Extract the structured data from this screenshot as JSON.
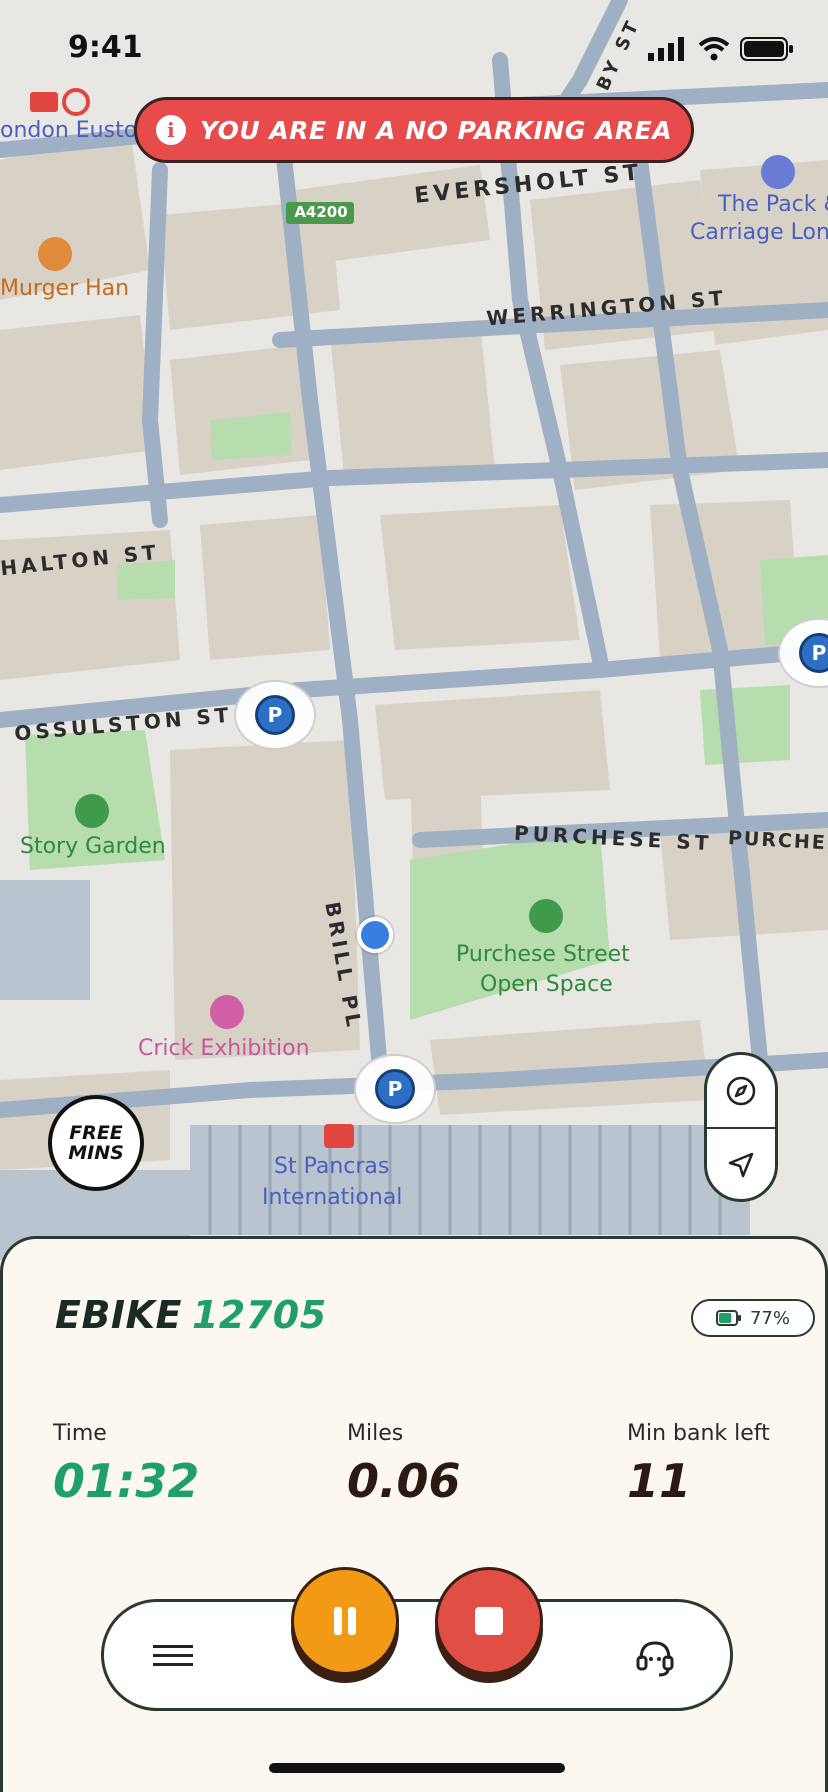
{
  "status_bar": {
    "time": "9:41"
  },
  "banner": {
    "text": "YOU ARE IN A NO PARKING AREA",
    "info_glyph": "i",
    "color": "#e84b4b"
  },
  "map": {
    "streets": {
      "eversholt": "EVERSHOLT ST",
      "werrington": "WERRINGTON ST",
      "chalton": "HALTON ST",
      "ossulston": "OSSULSTON ST",
      "purchese": "PURCHESE ST",
      "purchese2": "PURCHES",
      "brill": "BRILL PL",
      "top": "BY ST",
      "road_badge": "A4200"
    },
    "pois": {
      "euston": "ondon Eustor",
      "burger": "Murger Han",
      "pack": "The Pack &",
      "pack2": "Carriage Lon",
      "story_garden": "Story Garden",
      "purchese_space": "Purchese Street",
      "purchese_space2": "Open Space",
      "crick": "Crick Exhibition",
      "st_pancras": "St Pancras",
      "st_pancras2": "International"
    },
    "parking_letter": "P"
  },
  "free_mins": {
    "line1": "FREE",
    "line2": "MINS"
  },
  "ride": {
    "type": "EBIKE",
    "number": "12705",
    "battery": "77%",
    "battery_level": 0.77,
    "stats": {
      "time": {
        "label": "Time",
        "value": "01:32"
      },
      "miles": {
        "label": "Miles",
        "value": "0.06"
      },
      "bank": {
        "label": "Min bank left",
        "value": "11"
      }
    }
  },
  "colors": {
    "accent_green": "#1fa06a",
    "pause": "#f29a16",
    "stop": "#e04e45",
    "parking": "#2d6fc4",
    "sheet_bg": "#fdf7f1"
  },
  "icons": {
    "menu": "hamburger-icon",
    "support": "headset-icon",
    "compass": "compass-icon",
    "locate": "location-arrow-icon",
    "pause": "pause-icon",
    "stop": "stop-icon"
  }
}
